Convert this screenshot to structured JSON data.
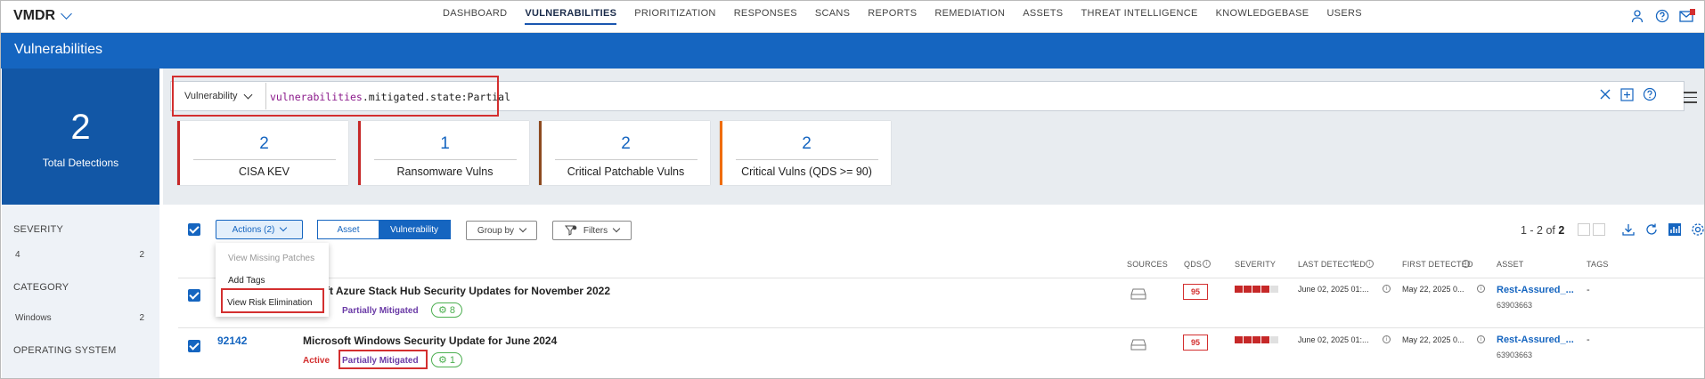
{
  "app": {
    "name": "VMDR"
  },
  "nav": {
    "items": [
      "DASHBOARD",
      "VULNERABILITIES",
      "PRIORITIZATION",
      "RESPONSES",
      "SCANS",
      "REPORTS",
      "REMEDIATION",
      "ASSETS",
      "THREAT INTELLIGENCE",
      "KNOWLEDGEBASE",
      "USERS"
    ],
    "active": "VULNERABILITIES"
  },
  "page": {
    "title": "Vulnerabilities"
  },
  "total": {
    "count": "2",
    "label": "Total Detections"
  },
  "filters": {
    "severity": {
      "label": "SEVERITY",
      "value": "4",
      "count": "2"
    },
    "category": {
      "label": "CATEGORY",
      "value": "Windows",
      "count": "2"
    },
    "os": {
      "label": "OPERATING SYSTEM"
    }
  },
  "search": {
    "selector": "Vulnerability",
    "query_key": "vulnerabilities",
    "query_rest": ".mitigated.state:Partial"
  },
  "cards": [
    {
      "value": "2",
      "label": "CISA KEV",
      "color": "#c62828"
    },
    {
      "value": "1",
      "label": "Ransomware Vulns",
      "color": "#c62828"
    },
    {
      "value": "2",
      "label": "Critical Patchable Vulns",
      "color": "#8d4a1f"
    },
    {
      "value": "2",
      "label": "Critical Vulns (QDS >= 90)",
      "color": "#ef6c00"
    }
  ],
  "toolbar": {
    "actions": "Actions (2)",
    "seg_asset": "Asset",
    "seg_vuln": "Vulnerability",
    "group_by": "Group by",
    "filters": "Filters",
    "pager_range": "1 - 2 of",
    "pager_total": "2"
  },
  "dropdown": {
    "items": [
      "View Missing Patches",
      "Add Tags",
      "View Risk Elimination"
    ]
  },
  "columns": {
    "sources": "SOURCES",
    "qds": "QDS",
    "severity": "SEVERITY",
    "last_detected": "LAST DETECTED",
    "first_detected": "FIRST DETECTED",
    "asset": "ASSET",
    "tags": "TAGS"
  },
  "rows": [
    {
      "qid": "",
      "title": "rosoft Azure Stack Hub Security Updates for November 2022",
      "status": "",
      "mitigation": "Partially Mitigated",
      "count": "8",
      "qds": "95",
      "last": "June 02, 2025 01:...",
      "first": "May 22, 2025 0...",
      "asset": "Rest-Assured_...",
      "asset_id": "63903663",
      "tags": "-"
    },
    {
      "qid": "92142",
      "title": "Microsoft Windows Security Update for June 2024",
      "status": "Active",
      "mitigation": "Partially Mitigated",
      "count": "1",
      "qds": "95",
      "last": "June 02, 2025 01:...",
      "first": "May 22, 2025 0...",
      "asset": "Rest-Assured_...",
      "asset_id": "63903663",
      "tags": "-"
    }
  ]
}
